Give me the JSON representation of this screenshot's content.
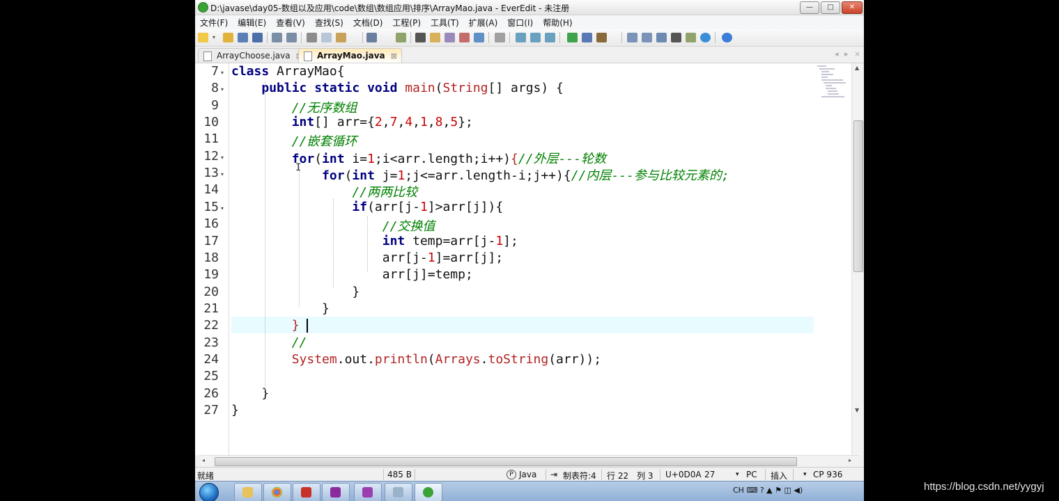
{
  "window": {
    "title": "D:\\javase\\day05-数组以及应用\\code\\数组\\数组应用\\排序\\ArrayMao.java - EverEdit - 未注册",
    "controls": {
      "minimize": "—",
      "maximize": "□",
      "close": "✕"
    }
  },
  "menu": [
    "文件(F)",
    "编辑(E)",
    "查看(V)",
    "查找(S)",
    "文档(D)",
    "工程(P)",
    "工具(T)",
    "扩展(A)",
    "窗口(I)",
    "帮助(H)"
  ],
  "tabs": [
    {
      "label": "ArrayChoose.java",
      "close": "⊠"
    },
    {
      "label": "ArrayMao.java",
      "close": "⊠"
    }
  ],
  "tab_nav": {
    "prev": "◂",
    "next": "▸",
    "close": "×"
  },
  "editor": {
    "line_numbers": [
      "7",
      "8",
      "9",
      "10",
      "11",
      "12",
      "13",
      "14",
      "15",
      "16",
      "17",
      "18",
      "19",
      "20",
      "21",
      "22",
      "23",
      "24",
      "25",
      "26",
      "27"
    ],
    "fold_markers": [
      "▾",
      "▾",
      "",
      "",
      "",
      "▾",
      "▾",
      "",
      "▾",
      "",
      "",
      "",
      "",
      "",
      "",
      "",
      "",
      "",
      "",
      "",
      ""
    ],
    "cursor_glyph": "I"
  },
  "status": {
    "ready": "就绪",
    "size": "485 B",
    "lang_icon": "P",
    "language": "Java",
    "tab_icon": "⇥",
    "tab_setting": "制表符:4",
    "row": "行 22",
    "col": "列 3",
    "char_code": "U+0D0A",
    "char_value": "27",
    "eol_arrow": "▾",
    "eol": "PC",
    "insert": "插入",
    "enc_arrow": "▾",
    "encoding": "CP 936"
  },
  "taskbar": {
    "tray_text": "CH ⌨ ? ▲ ⚑ ◫ ◀)"
  },
  "watermark": "https://blog.csdn.net/yygyj",
  "colors": {
    "keyword": "#000080",
    "comment": "#008000",
    "number": "#cc0000",
    "class": "#b22222",
    "highlight_row": "#e8fbff",
    "active_tab": "#ffe9b6"
  }
}
